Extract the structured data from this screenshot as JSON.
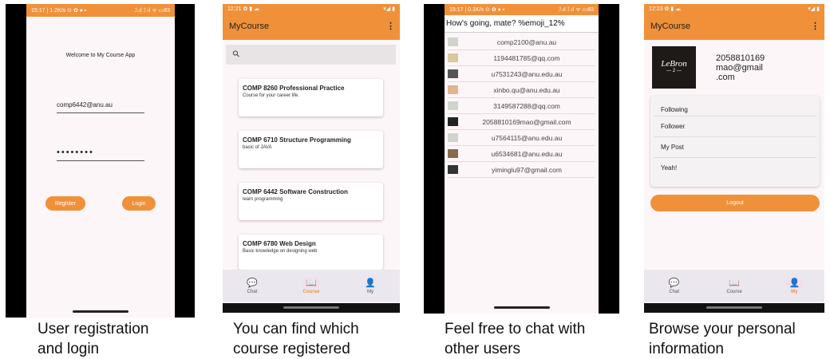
{
  "login": {
    "status_left": "15:17 | 1.2K/s ⊙ ✿ ● ▪",
    "status_right": "ℐ.ıl ℐ.ıl ᯤ ▭83",
    "welcome": "Welcome to My Course App",
    "email_value": "comp6442@anu.au",
    "password_mask": "••••••••",
    "register_label": "Register",
    "login_label": "Login",
    "caption_line1": "User registration",
    "caption_line2": "and login"
  },
  "course": {
    "status_left": "12:21 ✿ ▮ ☁",
    "status_right": "▾◢ ▮",
    "app_title": "MyCourse",
    "menu_glyph": "⋮",
    "search_glyph": "⚲",
    "courses": [
      {
        "title": "COMP 8260 Professional Practice",
        "desc": "Course for your career life."
      },
      {
        "title": "COMP 6710 Structure Programming",
        "desc": "basic of JAVA"
      },
      {
        "title": "COMP 6442 Software Construction",
        "desc": "learn programming"
      },
      {
        "title": "COMP 6780 Web Design",
        "desc": "Basic knowledge on designing web"
      }
    ],
    "nav": [
      {
        "label": "Chat",
        "icon": "chat-icon",
        "glyph": "💬"
      },
      {
        "label": "Course",
        "icon": "book-icon",
        "glyph": "📖"
      },
      {
        "label": "My",
        "icon": "person-icon",
        "glyph": "👤"
      }
    ],
    "caption_line1": "You can find which",
    "caption_line2": "course registered"
  },
  "chat": {
    "status_left": "15:17 | 0.1K/s ⊙ ✿ ● ▪",
    "status_right": "ℐ.ıl ℐ.ıl ᯤ ▭83",
    "header": "How's going, mate? %emoji_12%",
    "users": [
      "comp2100@anu.au",
      "1194481785@qq.com",
      "u7531243@anu.edu.au",
      "xinbo.qu@anu.edu.au",
      "3149587288@qq.com",
      "2058810169mao@gmail.com",
      "u7564115@anu.edu.au",
      "u6534681@anu.edu.au",
      "yiminglu97@gmail.com"
    ],
    "caption_line1": "Feel free to chat with",
    "caption_line2": "other users"
  },
  "my": {
    "status_left": "12:23 ✿ ▮ ☁",
    "status_right": "▾◢ ▮",
    "app_title": "MyCourse",
    "menu_glyph": "⋮",
    "avatar_text": "LeBron",
    "avatar_sub": "— 2 —",
    "profile_id": "2058810169",
    "profile_email_1": "mao@gmail",
    "profile_email_2": ".com",
    "menu": [
      "Following",
      "Follower",
      "My Post",
      "Yeah!"
    ],
    "logout_label": "Logout",
    "nav": [
      {
        "label": "Chat",
        "icon": "chat-icon",
        "glyph": "💬"
      },
      {
        "label": "Course",
        "icon": "book-icon",
        "glyph": "📖"
      },
      {
        "label": "My",
        "icon": "person-icon",
        "glyph": "👤"
      }
    ],
    "caption_line1": "Browse your personal",
    "caption_line2": "information"
  },
  "colors": {
    "accent": "#f0913a",
    "background": "#fdf6f8",
    "nav": "#ebe7ee"
  }
}
